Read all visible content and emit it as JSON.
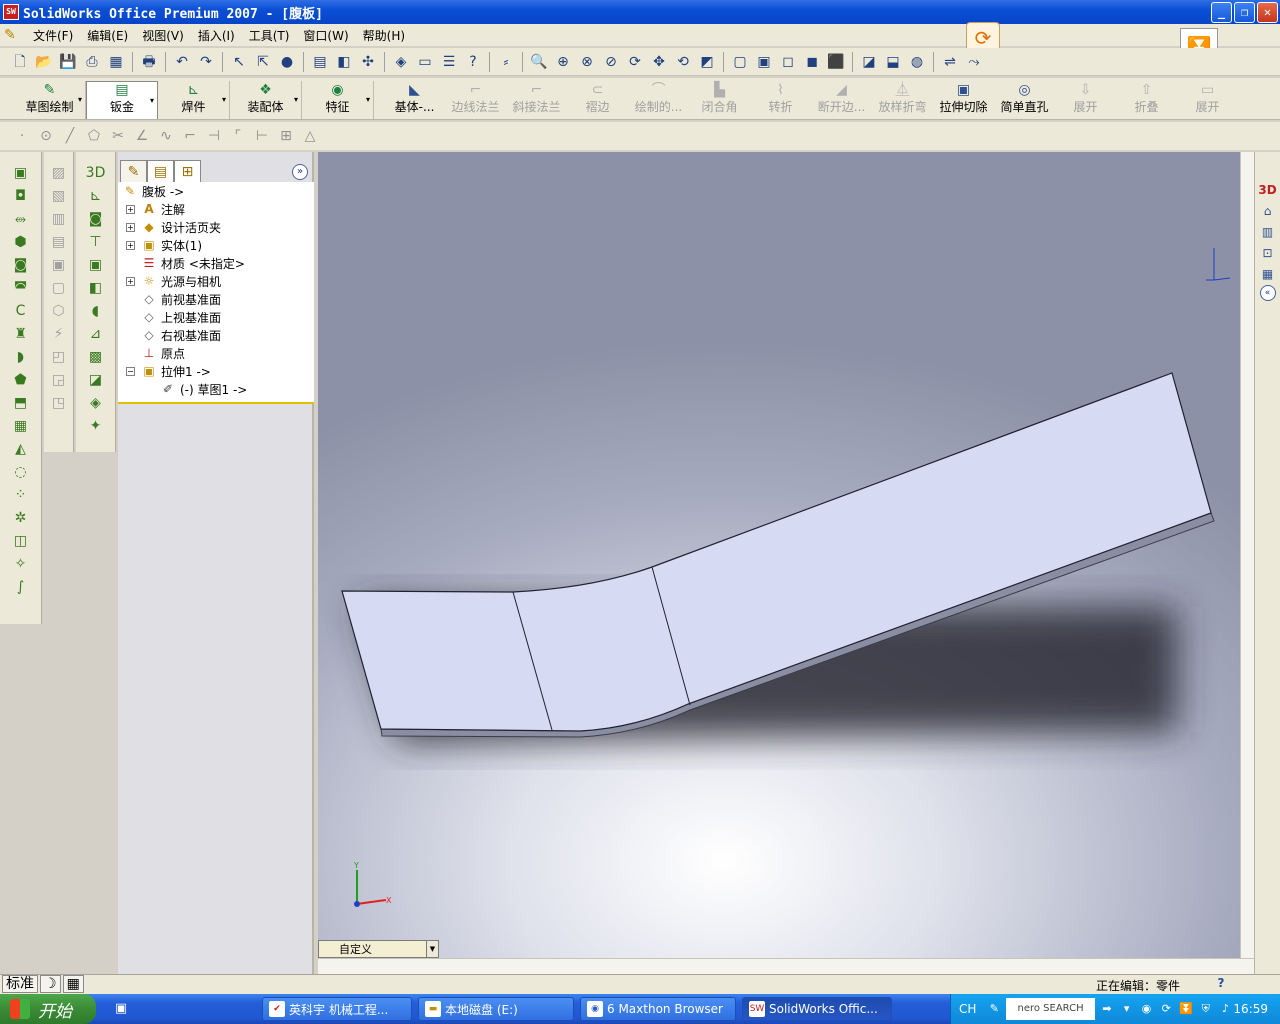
{
  "window": {
    "title": "SolidWorks Office Premium 2007 - [腹板]",
    "app_icon": "SW"
  },
  "menubar": {
    "items": [
      "文件(F)",
      "编辑(E)",
      "视图(V)",
      "插入(I)",
      "工具(T)",
      "窗口(W)",
      "帮助(H)"
    ]
  },
  "command_manager": {
    "tabs": [
      {
        "label": "草图绘制",
        "icon": "sketch-icon"
      },
      {
        "label": "钣金",
        "icon": "sheetmetal-icon"
      },
      {
        "label": "焊件",
        "icon": "weldment-icon"
      },
      {
        "label": "装配体",
        "icon": "assembly-icon"
      },
      {
        "label": "特征",
        "icon": "feature-icon"
      }
    ],
    "active_tab": "钣金",
    "buttons": [
      {
        "label": "基体-...",
        "enabled": true
      },
      {
        "label": "边线法兰",
        "enabled": false
      },
      {
        "label": "斜接法兰",
        "enabled": false
      },
      {
        "label": "褶边",
        "enabled": false
      },
      {
        "label": "绘制的...",
        "enabled": false
      },
      {
        "label": "闭合角",
        "enabled": false
      },
      {
        "label": "转折",
        "enabled": false
      },
      {
        "label": "断开边...",
        "enabled": false
      },
      {
        "label": "放样折弯",
        "enabled": false
      },
      {
        "label": "拉伸切除",
        "enabled": true
      },
      {
        "label": "简单直孔",
        "enabled": true
      },
      {
        "label": "展开",
        "enabled": false
      },
      {
        "label": "折叠",
        "enabled": false
      },
      {
        "label": "展开",
        "enabled": false
      }
    ]
  },
  "tree": {
    "root": "腹板 ->",
    "items": [
      {
        "label": "注解",
        "icon": "annotation-icon",
        "expandable": true,
        "sign": "+"
      },
      {
        "label": "设计活页夹",
        "icon": "design-binder-icon",
        "expandable": true,
        "sign": "+"
      },
      {
        "label": "实体(1)",
        "icon": "solid-bodies-icon",
        "expandable": true,
        "sign": "+"
      },
      {
        "label": "材质 <未指定>",
        "icon": "material-icon",
        "expandable": false,
        "sign": ""
      },
      {
        "label": "光源与相机",
        "icon": "lights-cameras-icon",
        "expandable": true,
        "sign": "+"
      },
      {
        "label": "前视基准面",
        "icon": "plane-icon",
        "expandable": false,
        "sign": ""
      },
      {
        "label": "上视基准面",
        "icon": "plane-icon",
        "expandable": false,
        "sign": ""
      },
      {
        "label": "右视基准面",
        "icon": "plane-icon",
        "expandable": false,
        "sign": ""
      },
      {
        "label": "原点",
        "icon": "origin-icon",
        "expandable": false,
        "sign": ""
      },
      {
        "label": "拉伸1 ->",
        "icon": "extrude-icon",
        "expandable": true,
        "sign": "−"
      }
    ],
    "child": {
      "label": "(-) 草图1 ->",
      "icon": "sketch-icon"
    }
  },
  "viewport": {
    "view_orientation": "自定义",
    "triad_labels": {
      "x": "X",
      "y": "Y"
    }
  },
  "statusbar": {
    "tabs": [
      "标准",
      "",
      ""
    ],
    "editing": "正在编辑：零件",
    "help": "?"
  },
  "taskbar": {
    "start": "开始",
    "tasks": [
      {
        "label": "英科宇 机械工程...",
        "active": false
      },
      {
        "label": "本地磁盘 (E:)",
        "active": false
      },
      {
        "label": "6 Maxthon Browser",
        "active": false
      },
      {
        "label": "SolidWorks Offic...",
        "active": true
      }
    ],
    "lang": "CH",
    "nero": "nero SEARCH",
    "clock": "16:59"
  },
  "colors": {
    "title_bar": "#0a4fd6",
    "part_face": "#d6daf2",
    "part_edge": "#6e7288",
    "viewport_bg": "#a7abbf"
  }
}
